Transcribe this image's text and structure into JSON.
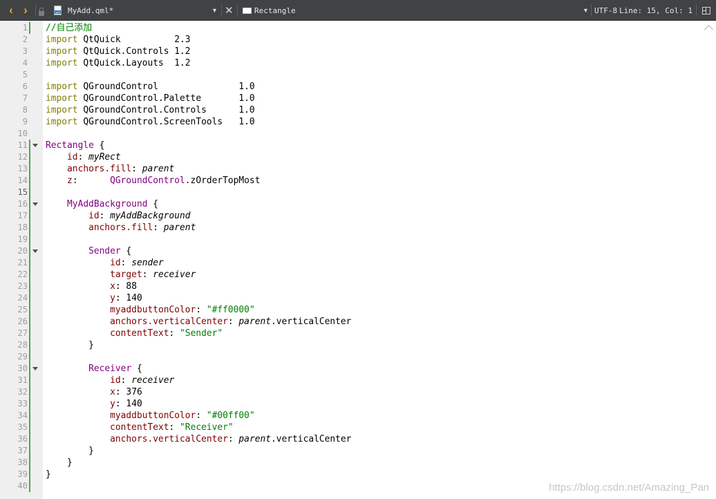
{
  "toolbar": {
    "nav_back_icon": "chevron-left-icon",
    "nav_forward_icon": "chevron-right-icon",
    "back_glyph": "‹",
    "forward_glyph": "›",
    "file_type_tag": "qml",
    "file_name": "MyAdd.qml*",
    "dropdown_glyph": "▼",
    "close_glyph": "✕",
    "symbol_name": "Rectangle",
    "encoding": "UTF-8",
    "cursor_position": "Line: 15, Col: 1"
  },
  "editor": {
    "current_line": 15,
    "line_numbers": [
      "1",
      "2",
      "3",
      "4",
      "5",
      "6",
      "7",
      "8",
      "9",
      "10",
      "11",
      "12",
      "13",
      "14",
      "15",
      "16",
      "17",
      "18",
      "19",
      "20",
      "21",
      "22",
      "23",
      "24",
      "25",
      "26",
      "27",
      "28",
      "29",
      "30",
      "31",
      "32",
      "33",
      "34",
      "35",
      "36",
      "37",
      "38",
      "39",
      "40"
    ],
    "fold_lines": [
      11,
      16,
      20,
      30
    ],
    "modified_ranges": [
      [
        1,
        1
      ],
      [
        11,
        40
      ]
    ],
    "lines": [
      [
        [
          "//自己添加",
          "cmt"
        ]
      ],
      [
        [
          "import",
          "kw"
        ],
        [
          " QtQuick          2.3",
          ""
        ]
      ],
      [
        [
          "import",
          "kw"
        ],
        [
          " QtQuick.Controls 1.2",
          ""
        ]
      ],
      [
        [
          "import",
          "kw"
        ],
        [
          " QtQuick.Layouts  1.2",
          ""
        ]
      ],
      [],
      [
        [
          "import",
          "kw"
        ],
        [
          " QGroundControl               1.0",
          ""
        ]
      ],
      [
        [
          "import",
          "kw"
        ],
        [
          " QGroundControl.Palette       1.0",
          ""
        ]
      ],
      [
        [
          "import",
          "kw"
        ],
        [
          " QGroundControl.Controls      1.0",
          ""
        ]
      ],
      [
        [
          "import",
          "kw"
        ],
        [
          " QGroundControl.ScreenTools   1.0",
          ""
        ]
      ],
      [],
      [
        [
          "Rectangle",
          "typ"
        ],
        [
          " {",
          ""
        ]
      ],
      [
        [
          "    ",
          ""
        ],
        [
          "id",
          "prop"
        ],
        [
          ": ",
          ""
        ],
        [
          "myRect",
          "ital"
        ]
      ],
      [
        [
          "    ",
          ""
        ],
        [
          "anchors.fill",
          "prop"
        ],
        [
          ": ",
          ""
        ],
        [
          "parent",
          "ital"
        ]
      ],
      [
        [
          "    ",
          ""
        ],
        [
          "z",
          "prop"
        ],
        [
          ":      ",
          ""
        ],
        [
          "QGroundControl",
          "typ"
        ],
        [
          ".zOrderTopMost",
          ""
        ]
      ],
      [],
      [
        [
          "    ",
          ""
        ],
        [
          "MyAddBackground",
          "typ"
        ],
        [
          " {",
          ""
        ]
      ],
      [
        [
          "        ",
          ""
        ],
        [
          "id",
          "prop"
        ],
        [
          ": ",
          ""
        ],
        [
          "myAddBackground",
          "ital"
        ]
      ],
      [
        [
          "        ",
          ""
        ],
        [
          "anchors.fill",
          "prop"
        ],
        [
          ": ",
          ""
        ],
        [
          "parent",
          "ital"
        ]
      ],
      [],
      [
        [
          "        ",
          ""
        ],
        [
          "Sender",
          "typ"
        ],
        [
          " {",
          ""
        ]
      ],
      [
        [
          "            ",
          ""
        ],
        [
          "id",
          "prop"
        ],
        [
          ": ",
          ""
        ],
        [
          "sender",
          "ital"
        ]
      ],
      [
        [
          "            ",
          ""
        ],
        [
          "target",
          "prop"
        ],
        [
          ": ",
          ""
        ],
        [
          "receiver",
          "ital"
        ]
      ],
      [
        [
          "            ",
          ""
        ],
        [
          "x",
          "prop"
        ],
        [
          ": 88",
          ""
        ]
      ],
      [
        [
          "            ",
          ""
        ],
        [
          "y",
          "prop"
        ],
        [
          ": 140",
          ""
        ]
      ],
      [
        [
          "            ",
          ""
        ],
        [
          "myaddbuttonColor",
          "prop"
        ],
        [
          ": ",
          ""
        ],
        [
          "\"#ff0000\"",
          "str"
        ]
      ],
      [
        [
          "            ",
          ""
        ],
        [
          "anchors.verticalCenter",
          "prop"
        ],
        [
          ": ",
          ""
        ],
        [
          "parent",
          "ital"
        ],
        [
          ".verticalCenter",
          ""
        ]
      ],
      [
        [
          "            ",
          ""
        ],
        [
          "contentText",
          "prop"
        ],
        [
          ": ",
          ""
        ],
        [
          "\"Sender\"",
          "str"
        ]
      ],
      [
        [
          "        }",
          ""
        ]
      ],
      [],
      [
        [
          "        ",
          ""
        ],
        [
          "Receiver",
          "typ"
        ],
        [
          " {",
          ""
        ]
      ],
      [
        [
          "            ",
          ""
        ],
        [
          "id",
          "prop"
        ],
        [
          ": ",
          ""
        ],
        [
          "receiver",
          "ital"
        ]
      ],
      [
        [
          "            ",
          ""
        ],
        [
          "x",
          "prop"
        ],
        [
          ": 376",
          ""
        ]
      ],
      [
        [
          "            ",
          ""
        ],
        [
          "y",
          "prop"
        ],
        [
          ": 140",
          ""
        ]
      ],
      [
        [
          "            ",
          ""
        ],
        [
          "myaddbuttonColor",
          "prop"
        ],
        [
          ": ",
          ""
        ],
        [
          "\"#00ff00\"",
          "str"
        ]
      ],
      [
        [
          "            ",
          ""
        ],
        [
          "contentText",
          "prop"
        ],
        [
          ": ",
          ""
        ],
        [
          "\"Receiver\"",
          "str"
        ]
      ],
      [
        [
          "            ",
          ""
        ],
        [
          "anchors.verticalCenter",
          "prop"
        ],
        [
          ": ",
          ""
        ],
        [
          "parent",
          "ital"
        ],
        [
          ".verticalCenter",
          ""
        ]
      ],
      [
        [
          "        }",
          ""
        ]
      ],
      [
        [
          "    }",
          ""
        ]
      ],
      [
        [
          "}",
          ""
        ]
      ],
      []
    ]
  },
  "watermark": "https://blog.csdn.net/Amazing_Pan",
  "colors": {
    "toolbar_bg": "#404244",
    "nav_arrow": "#e8a93a",
    "keyword": "#808000",
    "type": "#800080",
    "property": "#800000",
    "string": "#008000",
    "modified_marker": "#4fa64f",
    "gutter_bg": "#efefef"
  }
}
